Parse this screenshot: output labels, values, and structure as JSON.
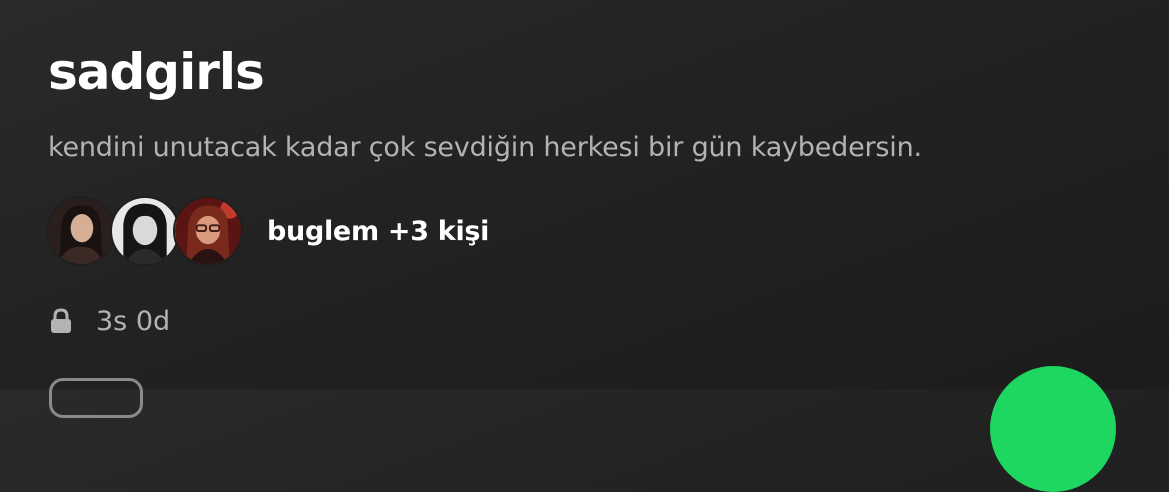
{
  "playlist": {
    "title": "sadgirls",
    "description": "kendini unutacak kadar çok sevdiğin herkesi bir gün kaybedersin.",
    "collaborators_text": "buglem +3 kişi",
    "duration": "3s 0d"
  },
  "icons": {
    "lock": "lock-icon",
    "play": "play-icon"
  },
  "colors": {
    "accent": "#1ed760",
    "background": "#222223",
    "secondary_text": "#b3b3b3"
  }
}
